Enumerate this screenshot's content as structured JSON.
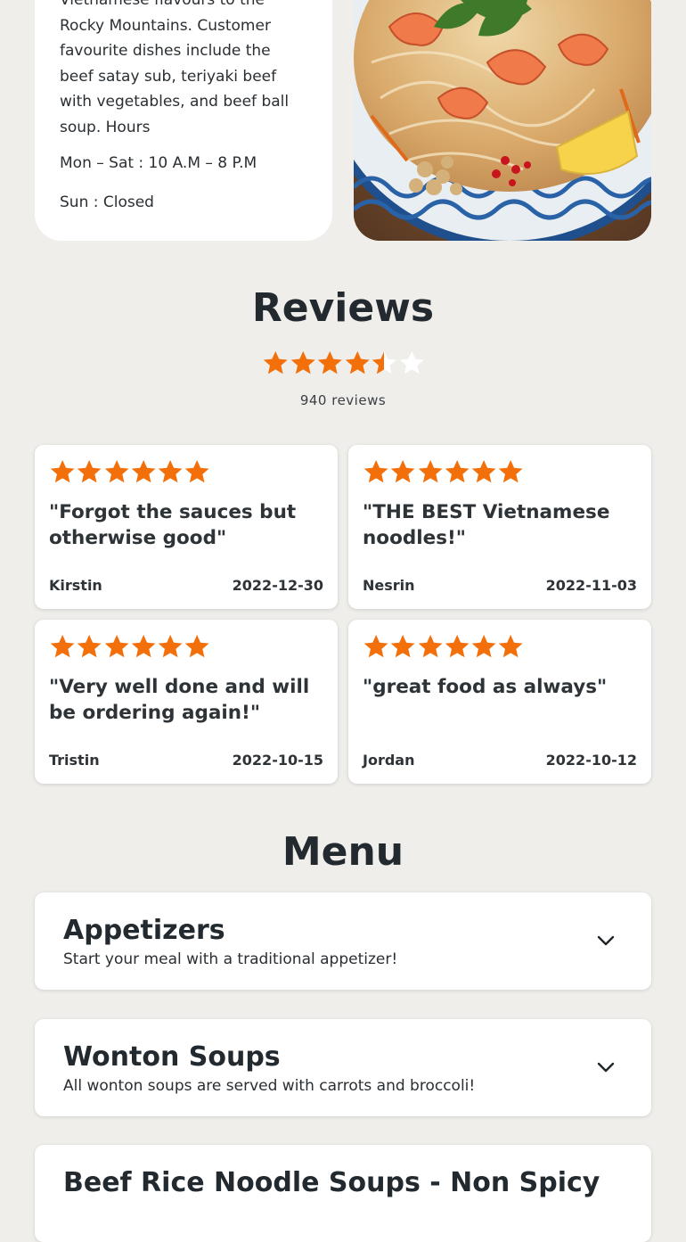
{
  "about": {
    "text": "Vietnamese flavours to the Rocky Mountains. Customer favourite dishes include the beef satay sub, teriyaki beef with vegetables, and beef ball soup. Hours",
    "hours": [
      "Mon – Sat : 10 A.M – 8 P.M",
      "Sun : Closed"
    ]
  },
  "photo": {
    "icon": "pad-thai-dish-photo"
  },
  "reviews": {
    "title": "Reviews",
    "rating": 4.5,
    "rating_max": 5,
    "count_label": "940 reviews",
    "star_color": "#f36f0a",
    "star_empty_color": "#ffffff",
    "items": [
      {
        "stars": 6,
        "quote": "\"Forgot the sauces but otherwise good\"",
        "author": "Kirstin",
        "date": "2022-12-30"
      },
      {
        "stars": 6,
        "quote": "\"THE BEST Vietnamese noodles!\"",
        "author": "Nesrin",
        "date": "2022-11-03"
      },
      {
        "stars": 6,
        "quote": "\"Very well done and will be ordering again!\"",
        "author": "Tristin",
        "date": "2022-10-15"
      },
      {
        "stars": 6,
        "quote": "\"great food as always\"",
        "author": "Jordan",
        "date": "2022-10-12"
      }
    ]
  },
  "menu": {
    "title": "Menu",
    "categories": [
      {
        "title": "Appetizers",
        "description": "Start your meal with a traditional appetizer!",
        "icon": "chevron-down-icon"
      },
      {
        "title": "Wonton Soups",
        "description": "All wonton soups are served with carrots and broccoli!",
        "icon": "chevron-down-icon"
      },
      {
        "title": "Beef Rice Noodle Soups - Non Spicy",
        "description": "",
        "icon": "chevron-down-icon"
      }
    ]
  }
}
